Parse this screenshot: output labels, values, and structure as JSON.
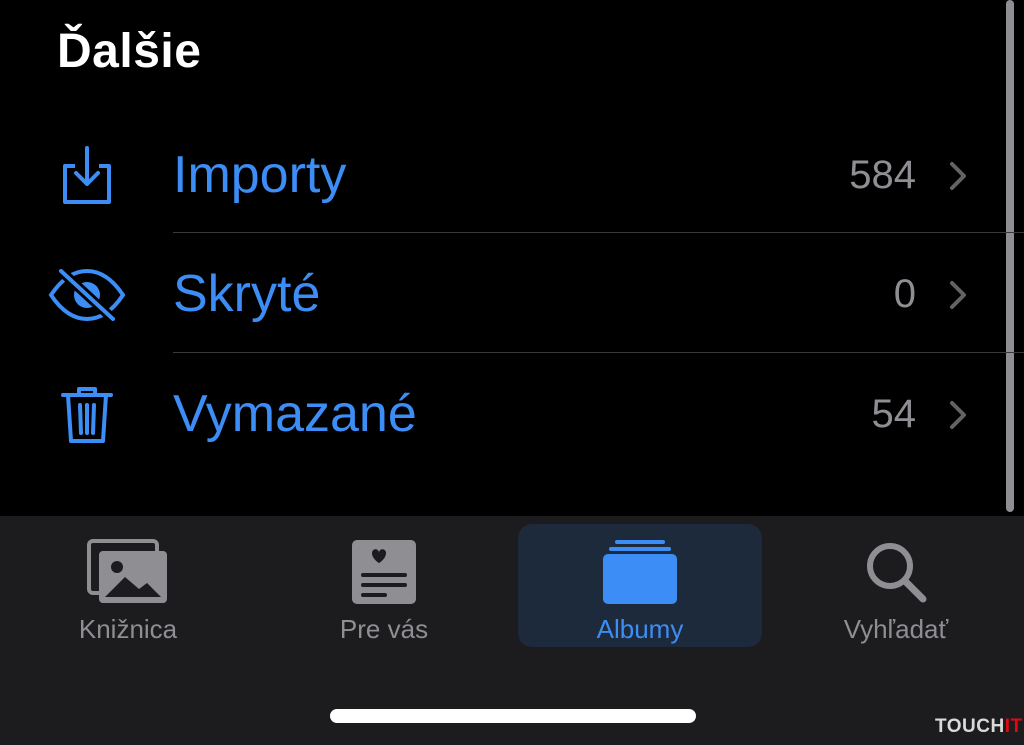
{
  "header": {
    "title": "Ďalšie"
  },
  "rows": [
    {
      "label": "Importy",
      "count": "584",
      "icon": "import-icon"
    },
    {
      "label": "Skryté",
      "count": "0",
      "icon": "eye-slash-icon"
    },
    {
      "label": "Vymazané",
      "count": "54",
      "icon": "trash-icon"
    }
  ],
  "tabbar": {
    "tabs": [
      {
        "label": "Knižnica",
        "icon": "photos-icon",
        "selected": false
      },
      {
        "label": "Pre vás",
        "icon": "for-you-icon",
        "selected": false
      },
      {
        "label": "Albumy",
        "icon": "albums-icon",
        "selected": true
      },
      {
        "label": "Vyhľadať",
        "icon": "search-icon",
        "selected": false
      }
    ]
  },
  "watermark": {
    "prefix": "TOUCH",
    "suffix": "IT"
  },
  "colors": {
    "accent": "#3c8ef6",
    "secondary_text": "#8e8e93",
    "background": "#000000",
    "tabbar_background": "#1c1c1e"
  }
}
